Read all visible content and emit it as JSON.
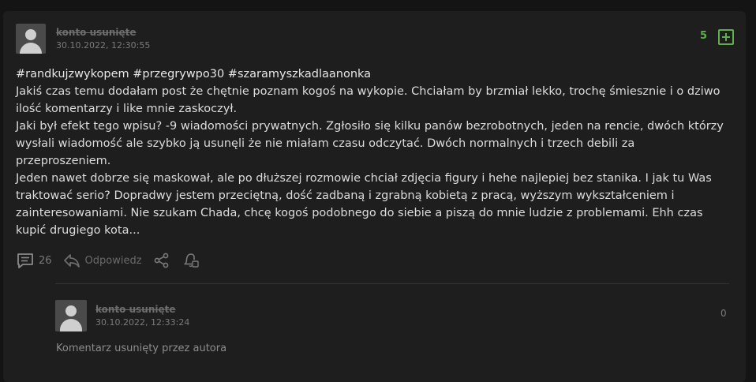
{
  "post": {
    "author": "konto usunięte",
    "date": "30.10.2022, 12:30:55",
    "votes": "5",
    "tags": "#randkujzwykopem #przegrywpo30 #szaramyszkadlaanonka",
    "paragraphs": [
      "Jakiś czas temu dodałam post że chętnie poznam kogoś na wykopie. Chciałam by brzmiał lekko, trochę śmiesznie i o dziwo ilość komentarzy i like mnie zaskoczył.",
      "Jaki był efekt tego wpisu? -9 wiadomości prywatnych. Zgłosiło się kilku panów bezrobotnych, jeden na rencie, dwóch którzy wysłali wiadomość ale szybko ją usunęli że nie miałam czasu odczytać. Dwóch normalnych i trzech debili za przeproszeniem.",
      "Jeden nawet dobrze się maskował, ale po dłuższej rozmowie chciał zdjęcia figury i hehe najlepiej bez stanika. I jak tu Was traktować serio? Dopradwy jestem przeciętną, dość zadbaną i zgrabną kobietą z pracą, wyższym wykształceniem i zainteresowaniami. Nie szukam Chada, chcę kogoś podobnego do siebie a piszą do mnie ludzie z problemami. Ehh czas kupić drugiego kota..."
    ],
    "comment_count": "26",
    "reply_label": "Odpowiedz"
  },
  "comment": {
    "author": "konto usunięte",
    "date": "30.10.2022, 12:33:24",
    "votes": "0",
    "text": "Komentarz usunięty przez autora"
  },
  "icons": [
    "comments-icon",
    "reply-icon",
    "share-icon",
    "notification-bell-icon",
    "plus-icon",
    "avatar-placeholder-icon"
  ],
  "colors": {
    "accent_green": "#5fb04a",
    "background": "#141414",
    "card": "#1e1e1e"
  }
}
